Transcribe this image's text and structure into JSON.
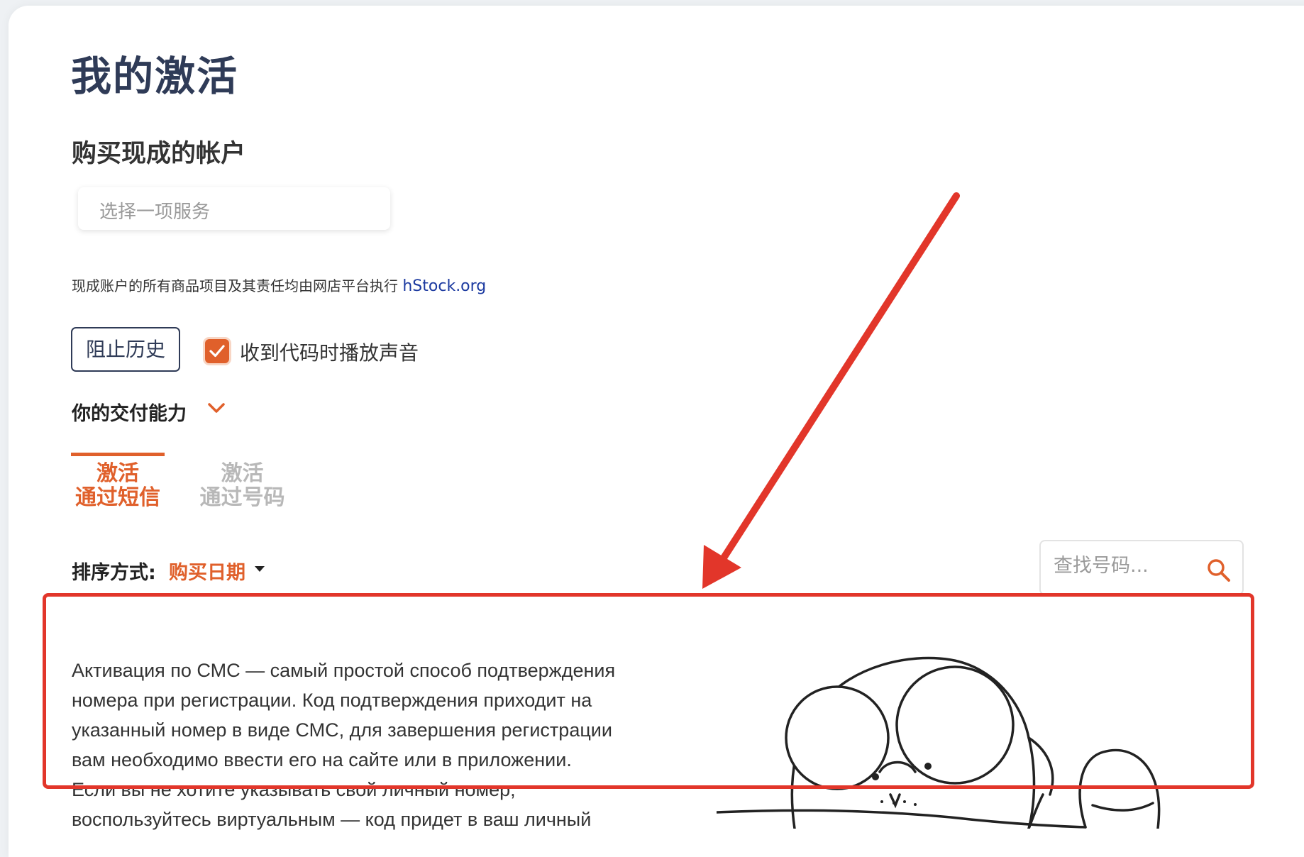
{
  "page": {
    "title": "我的激活"
  },
  "buy_section": {
    "title": "购买现成的帐户",
    "service_placeholder": "选择一项服务",
    "notice_text": "现成账户的所有商品项目及其责任均由网店平台执行",
    "notice_link": "hStock.org"
  },
  "controls": {
    "history_button": "阻止历史",
    "sound_checkbox_label": "收到代码时播放声音",
    "sound_checked": true,
    "capability_label": "你的交付能力"
  },
  "tabs": [
    {
      "line1": "激活",
      "line2": "通过短信",
      "active": true
    },
    {
      "line1": "激活",
      "line2": "通过号码",
      "active": false
    }
  ],
  "sort": {
    "label": "排序方式:",
    "value": "购买日期"
  },
  "search": {
    "placeholder": "查找号码..."
  },
  "description": {
    "lines": [
      "Активация по СМС — самый простой способ подтверждения",
      "номера при регистрации. Код подтверждения приходит на",
      "указанный номер в виде СМС, для завершения регистрации",
      "вам необходимо ввести его на сайте или в приложении.",
      "Если вы не хотите указывать свой личный номер,",
      "воспользуйтесь виртуальным — код придет в ваш личный"
    ]
  },
  "colors": {
    "accent": "#e0602b",
    "title": "#2f3b57",
    "annotation": "#e2362a"
  },
  "icons": {
    "checkbox": "check-icon",
    "capability": "chevron-down-icon",
    "sort": "caret-down-icon",
    "search": "search-icon"
  }
}
